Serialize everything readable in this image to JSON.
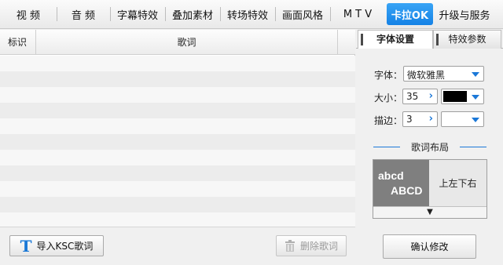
{
  "top_tabs": [
    {
      "label": "视  频",
      "active": false
    },
    {
      "label": "音  频",
      "active": false
    },
    {
      "label": "字幕特效",
      "active": false
    },
    {
      "label": "叠加素材",
      "active": false
    },
    {
      "label": "转场特效",
      "active": false
    },
    {
      "label": "画面风格",
      "active": false
    },
    {
      "label": "M T V",
      "active": false
    },
    {
      "label": "卡拉OK",
      "active": true
    },
    {
      "label": "升级与服务",
      "active": false
    }
  ],
  "lyrics": {
    "header": {
      "id_label": "标识",
      "lyric_label": "歌词"
    },
    "import_button": "导入KSC歌词",
    "import_icon": "T",
    "delete_button": "删除歌词"
  },
  "settings": {
    "tabs": [
      {
        "label": "字体设置",
        "active": true
      },
      {
        "label": "特效参数",
        "active": false
      }
    ],
    "font_label": "字体：",
    "font_value": "微软雅黑",
    "size_label": "大小：",
    "size_value": "35",
    "size_color": "#000000",
    "stroke_label": "描边：",
    "stroke_value": "3",
    "layout_title": "歌词布局",
    "layout_preview_line1": "abcd",
    "layout_preview_line2": "ABCD",
    "layout_option": "上左下右",
    "layout_more_arrow": "▼",
    "confirm_button": "确认修改"
  },
  "colors": {
    "accent": "#1b78d8",
    "active_tab": "#1582e6"
  }
}
